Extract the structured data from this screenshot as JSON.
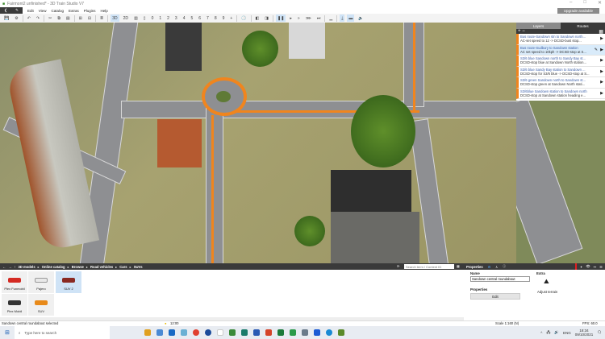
{
  "window": {
    "title": "Fairmont2 unfinished* - 3D Train Studio V7",
    "minimize": "–",
    "maximize": "□",
    "close": "✕"
  },
  "menu": [
    "Edit",
    "View",
    "Catalog",
    "Extras",
    "Plugins",
    "Help"
  ],
  "upgrade": "Upgrade available",
  "toolbar": {
    "view3d": "3D",
    "view2d": "2D",
    "layers": [
      "0",
      "1",
      "2",
      "3",
      "4",
      "5",
      "6",
      "7",
      "8",
      "9"
    ],
    "add": "+"
  },
  "panel": {
    "tabs": [
      "Layers",
      "Routes"
    ],
    "routes": [
      {
        "title": "Bus route-Sandown stn to Sandown north...",
        "sub": "AC-set speed to 12 -> DCSD-bust stop..."
      },
      {
        "title": "Bus route-Sudbury to Sandown station",
        "sub": "AC set speed to 10kph -> DCSD-stop at S..."
      },
      {
        "title": "S3/6 blue Sandown north to Sandy Bay st...",
        "sub": "DCSD-stop blue at Sandown North station..."
      },
      {
        "title": "S3/6 blue Sandy Bay station to Sandown ...",
        "sub": "DCSD-stop for S3/6 blue -> DCSD-stop at S..."
      },
      {
        "title": "S3/6 green Sandown north to Sandown st...",
        "sub": "DCSD-stop green at Sandown North stati..."
      },
      {
        "title": "S3/6blue Sandown station to Sandown north",
        "sub": "DCSD-stop at Sandown station heading e..."
      }
    ]
  },
  "breadcrumb": [
    "3D models",
    "Online catalog",
    "Browse",
    "Road vehicles",
    "Cars",
    "SUVs"
  ],
  "search": {
    "placeholder": "Search term / Content ID"
  },
  "properties": {
    "tab": "Properties",
    "name_label": "Name",
    "name_value": "Sandown central roundabout",
    "props_label": "Properties",
    "edit": "Edit",
    "extra_label": "Extra",
    "adjust": "Adjust terrain"
  },
  "catalog": [
    {
      "label": "Plex Funmobil",
      "color": "#d42a22"
    },
    {
      "label": "Pajero",
      "color": "#e8e8e8"
    },
    {
      "label": "SUV 2",
      "color": "#8a2a22"
    },
    {
      "label": "Plex Mobil",
      "color": "#333333"
    },
    {
      "label": "SUV",
      "color": "#e88a1a"
    }
  ],
  "status": {
    "message": "Sandown central roundabout selected",
    "time": "12:00",
    "scale": "Scale 1:160 (N)",
    "fps": "FPS: 60.0"
  },
  "taskbar": {
    "search": "Type here to search",
    "lang": "ENG",
    "clock": "18:34",
    "date": "09/10/2021"
  }
}
